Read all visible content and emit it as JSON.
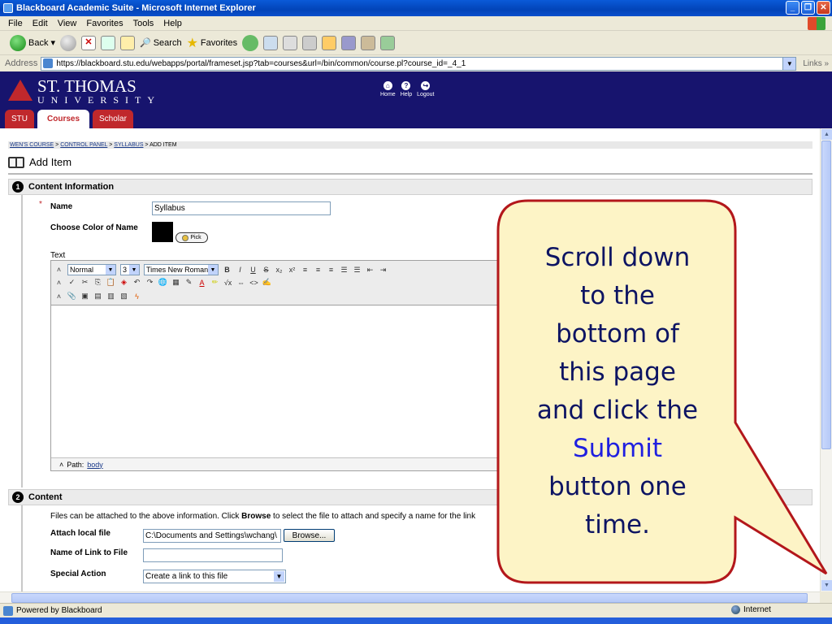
{
  "window": {
    "title": "Blackboard Academic Suite - Microsoft Internet Explorer",
    "buttons": [
      "_",
      "❐",
      "✕"
    ]
  },
  "menu": [
    "File",
    "Edit",
    "View",
    "Favorites",
    "Tools",
    "Help"
  ],
  "toolbar": {
    "back": "Back",
    "search": "Search",
    "favorites": "Favorites"
  },
  "address": {
    "label": "Address",
    "url": "https://blackboard.stu.edu/webapps/portal/frameset.jsp?tab=courses&url=/bin/common/course.pl?course_id=_4_1",
    "links": "Links »"
  },
  "banner": {
    "logo_name": "ST. THOMAS",
    "logo_sub": "UNIVERSITY",
    "nav": [
      {
        "label": "Home",
        "icon": "home-icon"
      },
      {
        "label": "Help",
        "icon": "help-icon"
      },
      {
        "label": "Logout",
        "icon": "logout-icon"
      }
    ],
    "tabs": [
      "STU",
      "Courses",
      "Scholar"
    ],
    "active_tab": "Courses",
    "accent": "#c0282c",
    "navy": "#17146e"
  },
  "breadcrumb": {
    "items": [
      "WEN'S COURSE",
      "CONTROL PANEL",
      "SYLLABUS"
    ],
    "current": "ADD ITEM",
    "sep": " > "
  },
  "page_title": "Add Item",
  "section1": {
    "num": "1",
    "title": "Content Information",
    "name_label": "Name",
    "name_required": "*",
    "name_value": "Syllabus",
    "color_label": "Choose Color of Name",
    "pick_label": "Pick",
    "text_label": "Text",
    "editor": {
      "format": "Normal",
      "size": "3",
      "font": "Times New Roman",
      "path_label": "Path:",
      "path_value": "body"
    }
  },
  "section2": {
    "num": "2",
    "title": "Content",
    "help": "Files can be attached to the above information. Click ",
    "help_bold": "Browse",
    "help_rest": " to select the file to attach and specify a name for the link",
    "attach_label": "Attach local file",
    "attach_value": "C:\\Documents and Settings\\wchang\\",
    "browse_label": "Browse...",
    "link_name_label": "Name of Link to File",
    "link_name_value": "",
    "special_label": "Special Action",
    "special_value": "Create a link to this file"
  },
  "status": {
    "left": "Powered by Blackboard",
    "zone": "Internet"
  },
  "callout": {
    "lines": [
      "Scroll down",
      "to the",
      "bottom of",
      "this page",
      "and click the"
    ],
    "highlight": "Submit",
    "lines_after": [
      "button one",
      "time."
    ],
    "fill": "#fdf4c6",
    "stroke": "#b3171b"
  }
}
